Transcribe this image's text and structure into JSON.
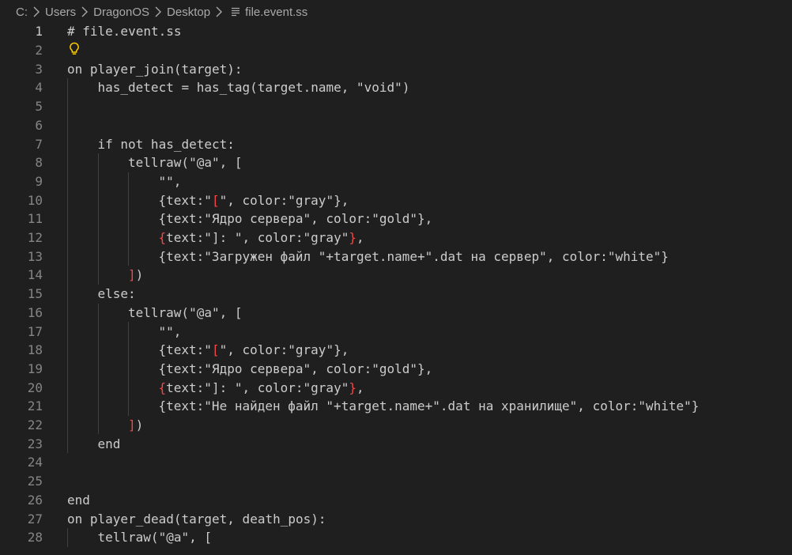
{
  "breadcrumb": {
    "items": [
      "C:",
      "Users",
      "DragonOS",
      "Desktop"
    ],
    "file": "file.event.ss"
  },
  "editor": {
    "active_line": 1,
    "lines": [
      {
        "n": "1",
        "indent": 0,
        "parts": [
          {
            "t": "# file.event.ss"
          }
        ]
      },
      {
        "n": "2",
        "indent": 0,
        "parts": [],
        "bulb": true
      },
      {
        "n": "3",
        "indent": 0,
        "parts": [
          {
            "t": "on player_join(target):"
          }
        ]
      },
      {
        "n": "4",
        "indent": 1,
        "parts": [
          {
            "t": "has_detect = has_tag(target.name, \"void\")"
          }
        ]
      },
      {
        "n": "5",
        "indent": 0,
        "parts": []
      },
      {
        "n": "6",
        "indent": 0,
        "parts": []
      },
      {
        "n": "7",
        "indent": 1,
        "parts": [
          {
            "t": "if not has_detect:"
          }
        ]
      },
      {
        "n": "8",
        "indent": 2,
        "parts": [
          {
            "t": "tellraw(\"@a\", ["
          }
        ]
      },
      {
        "n": "9",
        "indent": 3,
        "parts": [
          {
            "t": "\"\","
          }
        ]
      },
      {
        "n": "10",
        "indent": 3,
        "parts": [
          {
            "t": "{text:\""
          },
          {
            "t": "[",
            "red": true
          },
          {
            "t": "\", color:\"gray\"},"
          }
        ]
      },
      {
        "n": "11",
        "indent": 3,
        "parts": [
          {
            "t": "{text:\"Ядро сервера\", color:\"gold\"},"
          }
        ]
      },
      {
        "n": "12",
        "indent": 3,
        "parts": [
          {
            "t": "{",
            "red": true
          },
          {
            "t": "text:\"]: \", color:\"gray\""
          },
          {
            "t": "}",
            "red": true
          },
          {
            "t": ","
          }
        ]
      },
      {
        "n": "13",
        "indent": 3,
        "parts": [
          {
            "t": "{text:\"Загружен файл \"+target.name+\".dat на сервер\", color:\"white\"}"
          }
        ]
      },
      {
        "n": "14",
        "indent": 2,
        "parts": [
          {
            "t": "]",
            "red": true
          },
          {
            "t": ")"
          }
        ]
      },
      {
        "n": "15",
        "indent": 1,
        "parts": [
          {
            "t": "else:"
          }
        ]
      },
      {
        "n": "16",
        "indent": 2,
        "parts": [
          {
            "t": "tellraw(\"@a\", ["
          }
        ]
      },
      {
        "n": "17",
        "indent": 3,
        "parts": [
          {
            "t": "\"\","
          }
        ]
      },
      {
        "n": "18",
        "indent": 3,
        "parts": [
          {
            "t": "{text:\""
          },
          {
            "t": "[",
            "red": true
          },
          {
            "t": "\", color:\"gray\"},"
          }
        ]
      },
      {
        "n": "19",
        "indent": 3,
        "parts": [
          {
            "t": "{text:\"Ядро сервера\", color:\"gold\"},"
          }
        ]
      },
      {
        "n": "20",
        "indent": 3,
        "parts": [
          {
            "t": "{",
            "red": true
          },
          {
            "t": "text:\"]: \", color:\"gray\""
          },
          {
            "t": "}",
            "red": true
          },
          {
            "t": ","
          }
        ]
      },
      {
        "n": "21",
        "indent": 3,
        "parts": [
          {
            "t": "{text:\"Не найден файл \"+target.name+\".dat на хранилище\", color:\"white\"}"
          }
        ]
      },
      {
        "n": "22",
        "indent": 2,
        "parts": [
          {
            "t": "]",
            "red": true
          },
          {
            "t": ")"
          }
        ]
      },
      {
        "n": "23",
        "indent": 1,
        "parts": [
          {
            "t": "end"
          }
        ]
      },
      {
        "n": "24",
        "indent": 0,
        "parts": []
      },
      {
        "n": "25",
        "indent": 0,
        "parts": []
      },
      {
        "n": "26",
        "indent": 0,
        "parts": [
          {
            "t": "end"
          }
        ]
      },
      {
        "n": "27",
        "indent": 0,
        "parts": [
          {
            "t": "on player_dead(target, death_pos):"
          }
        ]
      },
      {
        "n": "28",
        "indent": 1,
        "parts": [
          {
            "t": "tellraw(\"@a\", ["
          }
        ]
      }
    ]
  },
  "colors": {
    "background": "#1f1f1f",
    "text": "#cccccc",
    "line_number": "#858585",
    "bracket_error": "#f44747",
    "lightbulb": "#ffcc00"
  },
  "icons": [
    "chevron-right-icon",
    "file-lines-icon",
    "lightbulb-icon"
  ]
}
